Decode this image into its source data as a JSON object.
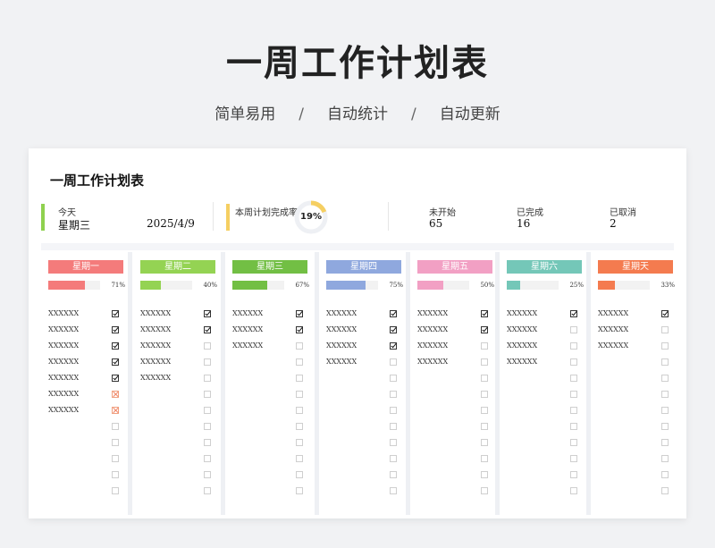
{
  "hero": {
    "title": "一周工作计划表",
    "subtitle_parts": [
      "简单易用",
      "自动统计",
      "自动更新"
    ],
    "separator": "/"
  },
  "sheet": {
    "title": "一周工作计划表",
    "today_label": "今天",
    "today_value": "星期三",
    "date_value": "2025/4/9",
    "completion_label": "本周计划完成率",
    "completion_rate": 19,
    "completion_text": "19%",
    "not_started_label": "未开始",
    "not_started_value": "65",
    "completed_label": "已完成",
    "completed_value": "16",
    "cancelled_label": "已取消",
    "cancelled_value": "2"
  },
  "colors": {
    "today_bar": "#8fd14f",
    "completion_bar": "#f5cf62",
    "donut": "#f5cf62"
  },
  "days": [
    {
      "name": "星期一",
      "color": "#f47b7b",
      "progress": 71,
      "progress_text": "71%",
      "tasks": [
        {
          "name": "XXXXXX",
          "state": "done"
        },
        {
          "name": "XXXXXX",
          "state": "done"
        },
        {
          "name": "XXXXXX",
          "state": "done"
        },
        {
          "name": "XXXXXX",
          "state": "done"
        },
        {
          "name": "XXXXXX",
          "state": "done"
        },
        {
          "name": "XXXXXX",
          "state": "cancel"
        },
        {
          "name": "XXXXXX",
          "state": "cancel"
        },
        {
          "name": "",
          "state": "empty"
        },
        {
          "name": "",
          "state": "empty"
        },
        {
          "name": "",
          "state": "empty"
        },
        {
          "name": "",
          "state": "empty"
        },
        {
          "name": "",
          "state": "empty"
        }
      ]
    },
    {
      "name": "星期二",
      "color": "#94d353",
      "progress": 40,
      "progress_text": "40%",
      "tasks": [
        {
          "name": "XXXXXX",
          "state": "done"
        },
        {
          "name": "XXXXXX",
          "state": "done"
        },
        {
          "name": "XXXXXX",
          "state": "open"
        },
        {
          "name": "XXXXXX",
          "state": "open"
        },
        {
          "name": "XXXXXX",
          "state": "open"
        },
        {
          "name": "",
          "state": "empty"
        },
        {
          "name": "",
          "state": "empty"
        },
        {
          "name": "",
          "state": "empty"
        },
        {
          "name": "",
          "state": "empty"
        },
        {
          "name": "",
          "state": "empty"
        },
        {
          "name": "",
          "state": "empty"
        },
        {
          "name": "",
          "state": "empty"
        }
      ]
    },
    {
      "name": "星期三",
      "color": "#72bf44",
      "progress": 67,
      "progress_text": "67%",
      "tasks": [
        {
          "name": "XXXXXX",
          "state": "done"
        },
        {
          "name": "XXXXXX",
          "state": "done"
        },
        {
          "name": "XXXXXX",
          "state": "open"
        },
        {
          "name": "",
          "state": "empty"
        },
        {
          "name": "",
          "state": "empty"
        },
        {
          "name": "",
          "state": "empty"
        },
        {
          "name": "",
          "state": "empty"
        },
        {
          "name": "",
          "state": "empty"
        },
        {
          "name": "",
          "state": "empty"
        },
        {
          "name": "",
          "state": "empty"
        },
        {
          "name": "",
          "state": "empty"
        },
        {
          "name": "",
          "state": "empty"
        }
      ]
    },
    {
      "name": "星期四",
      "color": "#8fa8de",
      "progress": 75,
      "progress_text": "75%",
      "tasks": [
        {
          "name": "XXXXXX",
          "state": "done"
        },
        {
          "name": "XXXXXX",
          "state": "done"
        },
        {
          "name": "XXXXXX",
          "state": "done"
        },
        {
          "name": "XXXXXX",
          "state": "open"
        },
        {
          "name": "",
          "state": "empty"
        },
        {
          "name": "",
          "state": "empty"
        },
        {
          "name": "",
          "state": "empty"
        },
        {
          "name": "",
          "state": "empty"
        },
        {
          "name": "",
          "state": "empty"
        },
        {
          "name": "",
          "state": "empty"
        },
        {
          "name": "",
          "state": "empty"
        },
        {
          "name": "",
          "state": "empty"
        }
      ]
    },
    {
      "name": "星期五",
      "color": "#f2a0c4",
      "progress": 50,
      "progress_text": "50%",
      "tasks": [
        {
          "name": "XXXXXX",
          "state": "done"
        },
        {
          "name": "XXXXXX",
          "state": "done"
        },
        {
          "name": "XXXXXX",
          "state": "open"
        },
        {
          "name": "XXXXXX",
          "state": "open"
        },
        {
          "name": "",
          "state": "empty"
        },
        {
          "name": "",
          "state": "empty"
        },
        {
          "name": "",
          "state": "empty"
        },
        {
          "name": "",
          "state": "empty"
        },
        {
          "name": "",
          "state": "empty"
        },
        {
          "name": "",
          "state": "empty"
        },
        {
          "name": "",
          "state": "empty"
        },
        {
          "name": "",
          "state": "empty"
        }
      ]
    },
    {
      "name": "星期六",
      "color": "#74c7b8",
      "progress": 25,
      "progress_text": "25%",
      "tasks": [
        {
          "name": "XXXXXX",
          "state": "done"
        },
        {
          "name": "XXXXXX",
          "state": "open"
        },
        {
          "name": "XXXXXX",
          "state": "open"
        },
        {
          "name": "XXXXXX",
          "state": "open"
        },
        {
          "name": "",
          "state": "empty"
        },
        {
          "name": "",
          "state": "empty"
        },
        {
          "name": "",
          "state": "empty"
        },
        {
          "name": "",
          "state": "empty"
        },
        {
          "name": "",
          "state": "empty"
        },
        {
          "name": "",
          "state": "empty"
        },
        {
          "name": "",
          "state": "empty"
        },
        {
          "name": "",
          "state": "empty"
        }
      ]
    },
    {
      "name": "星期天",
      "color": "#f47b4f",
      "progress": 33,
      "progress_text": "33%",
      "tasks": [
        {
          "name": "XXXXXX",
          "state": "done"
        },
        {
          "name": "XXXXXX",
          "state": "open"
        },
        {
          "name": "XXXXXX",
          "state": "open"
        },
        {
          "name": "",
          "state": "empty"
        },
        {
          "name": "",
          "state": "empty"
        },
        {
          "name": "",
          "state": "empty"
        },
        {
          "name": "",
          "state": "empty"
        },
        {
          "name": "",
          "state": "empty"
        },
        {
          "name": "",
          "state": "empty"
        },
        {
          "name": "",
          "state": "empty"
        },
        {
          "name": "",
          "state": "empty"
        },
        {
          "name": "",
          "state": "empty"
        }
      ]
    }
  ]
}
